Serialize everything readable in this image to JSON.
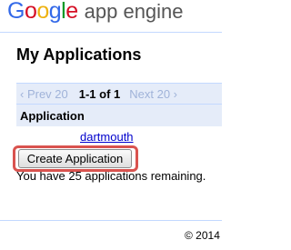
{
  "header": {
    "logo_letters": [
      {
        "char": "G",
        "color": "#3369e8"
      },
      {
        "char": "o",
        "color": "#d50f25"
      },
      {
        "char": "o",
        "color": "#eeb211"
      },
      {
        "char": "g",
        "color": "#3369e8"
      },
      {
        "char": "l",
        "color": "#009925"
      },
      {
        "char": "e",
        "color": "#d50f25"
      }
    ],
    "product_name": "app engine"
  },
  "page": {
    "title": "My Applications"
  },
  "pager": {
    "prev_label": "‹ Prev 20",
    "range_label": "1-1 of 1",
    "next_label": "Next 20 ›"
  },
  "table": {
    "column_header": "Application",
    "rows": [
      {
        "app_name": "dartmouth"
      }
    ]
  },
  "actions": {
    "create_label": "Create Application",
    "remaining_text": "You have 25 applications remaining."
  },
  "footer": {
    "copyright": "© 2014"
  },
  "colors": {
    "link": "#0000cc",
    "pager_bg": "#e5ecf9",
    "divider": "#c3d9ff",
    "highlight": "#d9534f"
  }
}
